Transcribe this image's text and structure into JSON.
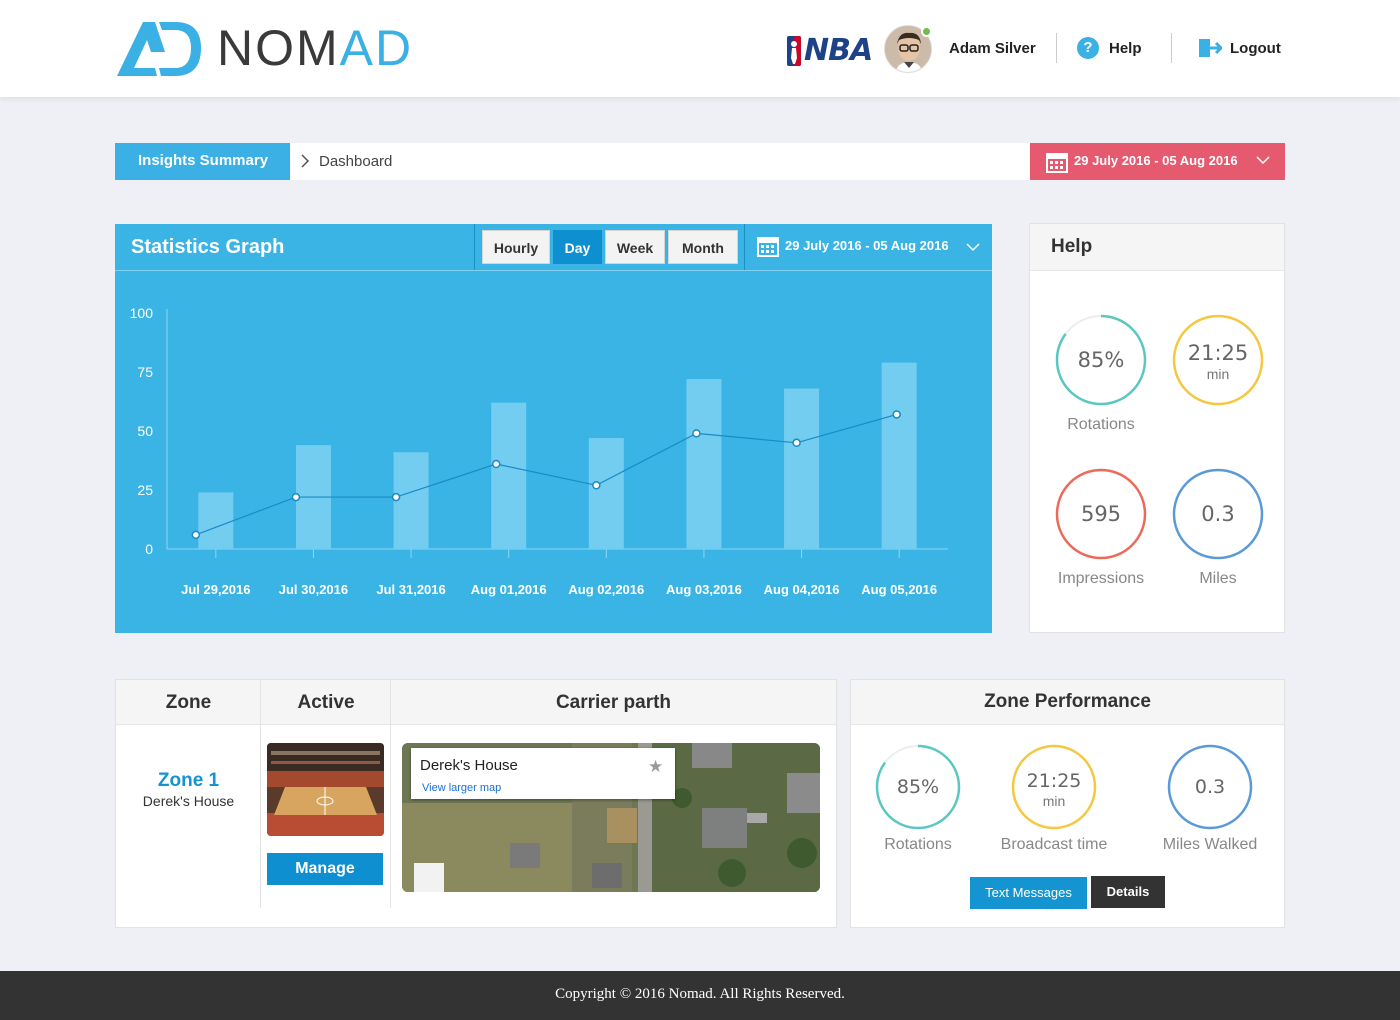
{
  "header": {
    "logo_text_a": "NOM",
    "logo_text_b": "AD",
    "league_logo": "NBA",
    "user_name": "Adam Silver",
    "help_label": "Help",
    "logout_label": "Logout",
    "accent_color": "#3bb0e5"
  },
  "breadcrumb": {
    "section": "Insights Summary",
    "page": "Dashboard",
    "date_range": "29 July 2016 - 05 Aug 2016",
    "date_color": "#e55a6e"
  },
  "stats": {
    "title": "Statistics Graph",
    "buttons": [
      "Hourly",
      "Day",
      "Week",
      "Month"
    ],
    "active_button": "Day",
    "date_range": "29 July 2016 - 05 Aug 2016"
  },
  "chart_data": {
    "type": "bar",
    "categories": [
      "Jul 29,2016",
      "Jul 30,2016",
      "Jul 31,2016",
      "Aug 01,2016",
      "Aug 02,2016",
      "Aug 03,2016",
      "Aug 04,2016",
      "Aug 05,2016"
    ],
    "series": [
      {
        "type": "bar",
        "values": [
          24,
          44,
          41,
          62,
          47,
          72,
          68,
          79
        ]
      },
      {
        "type": "line",
        "values": [
          6,
          22,
          22,
          36,
          27,
          49,
          45,
          57
        ]
      }
    ],
    "yticks": [
      0,
      25,
      50,
      75,
      100
    ],
    "ylim": [
      0,
      100
    ],
    "grid": false,
    "bar_color": "#72cdf1",
    "line_color": "#1a8ac5"
  },
  "help": {
    "title": "Help",
    "metrics": [
      {
        "value": "85%",
        "unit": "",
        "label": "Rotations",
        "color": "#5ac8c0",
        "fraction": 0.85
      },
      {
        "value": "21:25",
        "unit": "min",
        "label": "",
        "color": "#f5c842",
        "fraction": 1.0
      },
      {
        "value": "595",
        "unit": "",
        "label": "Impressions",
        "color": "#ec6a5a",
        "fraction": 1.0
      },
      {
        "value": "0.3",
        "unit": "",
        "label": "Miles",
        "color": "#5b9ad8",
        "fraction": 1.0
      }
    ]
  },
  "zone_table": {
    "headers": [
      "Zone",
      "Active",
      "Carrier parth"
    ],
    "zone_name": "Zone 1",
    "zone_location": "Derek's House",
    "manage_label": "Manage",
    "map": {
      "title": "Derek's House",
      "link": "View larger map"
    }
  },
  "zone_performance": {
    "title": "Zone Performance",
    "metrics": [
      {
        "value": "85%",
        "unit": "",
        "label": "Rotations",
        "color": "#5ac8c0",
        "fraction": 0.85
      },
      {
        "value": "21:25",
        "unit": "min",
        "label": "Broadcast time",
        "color": "#f5c842",
        "fraction": 1.0
      },
      {
        "value": "0.3",
        "unit": "",
        "label": "Miles Walked",
        "color": "#5b9ad8",
        "fraction": 1.0
      }
    ],
    "text_messages_label": "Text Messages",
    "details_label": "Details"
  },
  "footer": {
    "copyright": "Copyright © 2016 Nomad. All Rights Reserved."
  }
}
